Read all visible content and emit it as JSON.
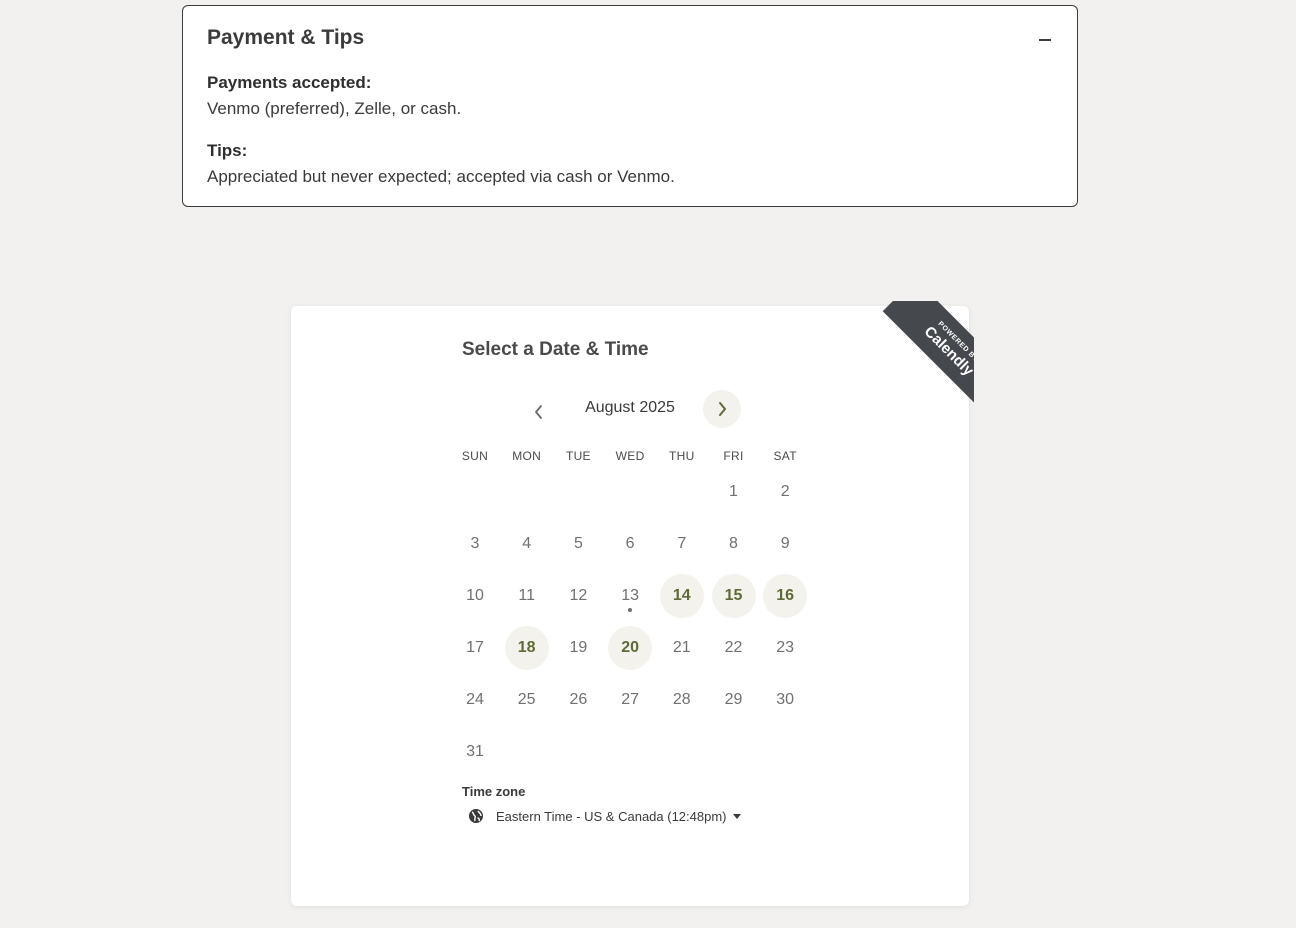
{
  "accordion": {
    "title": "Payment & Tips",
    "toggle_icon": "minus-icon",
    "payments_label": "Payments accepted:",
    "payments_text": "Venmo (preferred), Zelle, or cash.",
    "tips_label": "Tips:",
    "tips_text": "Appreciated but never expected; accepted via cash or Venmo."
  },
  "widget": {
    "ribbon_small": "POWERED BY",
    "ribbon_brand": "Calendly",
    "title": "Select a Date & Time",
    "month": "August 2025",
    "prev_icon": "chevron-left-icon",
    "next_icon": "chevron-right-icon",
    "weekdays": [
      "SUN",
      "MON",
      "TUE",
      "WED",
      "THU",
      "FRI",
      "SAT"
    ],
    "days": [
      {
        "n": "1",
        "avail": false
      },
      {
        "n": "2",
        "avail": false
      },
      {
        "n": "3",
        "avail": false
      },
      {
        "n": "4",
        "avail": false
      },
      {
        "n": "5",
        "avail": false
      },
      {
        "n": "6",
        "avail": false
      },
      {
        "n": "7",
        "avail": false
      },
      {
        "n": "8",
        "avail": false
      },
      {
        "n": "9",
        "avail": false
      },
      {
        "n": "10",
        "avail": false
      },
      {
        "n": "11",
        "avail": false
      },
      {
        "n": "12",
        "avail": false
      },
      {
        "n": "13",
        "avail": false,
        "today": true
      },
      {
        "n": "14",
        "avail": true
      },
      {
        "n": "15",
        "avail": true
      },
      {
        "n": "16",
        "avail": true
      },
      {
        "n": "17",
        "avail": false
      },
      {
        "n": "18",
        "avail": true
      },
      {
        "n": "19",
        "avail": false
      },
      {
        "n": "20",
        "avail": true
      },
      {
        "n": "21",
        "avail": false
      },
      {
        "n": "22",
        "avail": false
      },
      {
        "n": "23",
        "avail": false
      },
      {
        "n": "24",
        "avail": false
      },
      {
        "n": "25",
        "avail": false
      },
      {
        "n": "26",
        "avail": false
      },
      {
        "n": "27",
        "avail": false
      },
      {
        "n": "28",
        "avail": false
      },
      {
        "n": "29",
        "avail": false
      },
      {
        "n": "30",
        "avail": false
      },
      {
        "n": "31",
        "avail": false
      }
    ],
    "first_weekday_index": 5,
    "timezone_label": "Time zone",
    "timezone_value": "Eastern Time - US & Canada (12:48pm)",
    "globe_icon": "globe-icon"
  },
  "colors": {
    "page_bg": "#f2f1ef",
    "available_text": "#5e6b36",
    "available_bg": "#f3f2ec",
    "ribbon_bg": "#45494e"
  }
}
